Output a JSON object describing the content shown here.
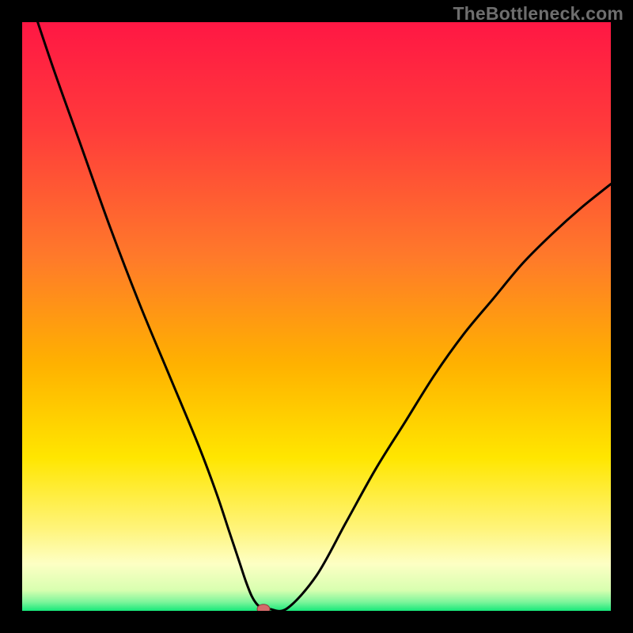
{
  "watermark": "TheBottleneck.com",
  "colors": {
    "frame_bg": "#000000",
    "gradient_stops": [
      {
        "offset": 0.0,
        "color": "#ff1744"
      },
      {
        "offset": 0.18,
        "color": "#ff3b3b"
      },
      {
        "offset": 0.4,
        "color": "#ff7a2a"
      },
      {
        "offset": 0.58,
        "color": "#ffb100"
      },
      {
        "offset": 0.74,
        "color": "#ffe600"
      },
      {
        "offset": 0.86,
        "color": "#fff47a"
      },
      {
        "offset": 0.92,
        "color": "#fdffc4"
      },
      {
        "offset": 0.965,
        "color": "#d8ffb0"
      },
      {
        "offset": 0.985,
        "color": "#7df59b"
      },
      {
        "offset": 1.0,
        "color": "#17e87a"
      }
    ],
    "curve": "#000000",
    "marker_fill": "#d46a6a",
    "marker_stroke": "#8e3a3a"
  },
  "chart_data": {
    "type": "line",
    "title": "",
    "xlabel": "",
    "ylabel": "",
    "xlim": [
      0,
      100
    ],
    "ylim": [
      0,
      100
    ],
    "series": [
      {
        "name": "bottleneck-curve",
        "x": [
          0,
          5,
          10,
          15,
          20,
          25,
          30,
          33,
          35,
          36,
          37,
          38,
          39,
          40,
          41,
          42,
          45,
          50,
          55,
          60,
          65,
          70,
          75,
          80,
          85,
          90,
          95,
          100
        ],
        "y": [
          108,
          93,
          79,
          65,
          52,
          40,
          28,
          20,
          14,
          11,
          8,
          5,
          2.5,
          1.0,
          0.4,
          0.3,
          0.4,
          6,
          15,
          24,
          32,
          40,
          47,
          53,
          59,
          64,
          68.5,
          72.5
        ]
      }
    ],
    "annotations": [
      {
        "name": "minimum-marker",
        "x": 41,
        "y": 0.3
      }
    ],
    "notes": "Curve shape is a deep V with minimum near x≈41%. Left branch starts near top-left, right branch rises toward ~72% at x=100. Background is a vertical heat gradient from red (top) to green (bottom) with a sharp green band at the very bottom."
  }
}
